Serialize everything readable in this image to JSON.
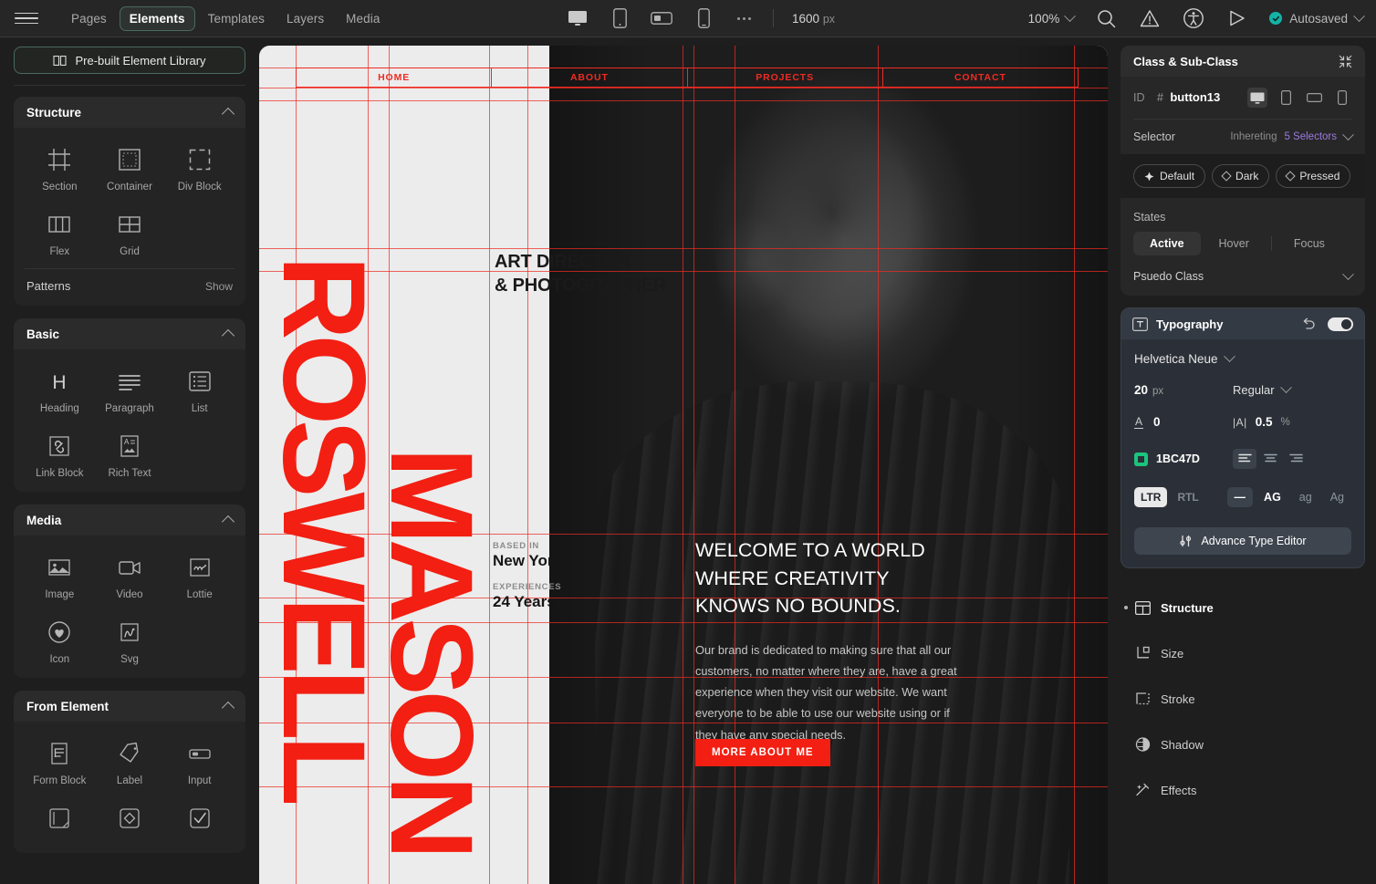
{
  "topbar": {
    "menu_icon": "hamburger-icon",
    "nav": [
      {
        "label": "Pages",
        "active": false
      },
      {
        "label": "Elements",
        "active": true
      },
      {
        "label": "Templates",
        "active": false
      },
      {
        "label": "Layers",
        "active": false
      },
      {
        "label": "Media",
        "active": false
      }
    ],
    "devices": [
      "desktop-icon",
      "tablet-icon",
      "landscape-icon",
      "mobile-icon"
    ],
    "more_label": "more-options-icon",
    "canvas_width": "1600",
    "canvas_width_unit": "px",
    "zoom": "100%",
    "icons": [
      "search-icon",
      "warning-icon",
      "accessibility-icon",
      "preview-play-icon"
    ],
    "autosave_label": "Autosaved",
    "accent_teal": "#13b3a6"
  },
  "left": {
    "library_button": "Pre-built Element Library",
    "sections": [
      {
        "title": "Structure",
        "items": [
          {
            "label": "Section",
            "icon": "section-icon"
          },
          {
            "label": "Container",
            "icon": "container-icon"
          },
          {
            "label": "Div Block",
            "icon": "div-block-icon"
          },
          {
            "label": "Flex",
            "icon": "flex-icon"
          },
          {
            "label": "Grid",
            "icon": "grid-icon"
          }
        ],
        "footer": {
          "label": "Patterns",
          "action": "Show"
        }
      },
      {
        "title": "Basic",
        "items": [
          {
            "label": "Heading",
            "icon": "heading-icon"
          },
          {
            "label": "Paragraph",
            "icon": "paragraph-icon"
          },
          {
            "label": "List",
            "icon": "list-icon"
          },
          {
            "label": "Link Block",
            "icon": "link-block-icon"
          },
          {
            "label": "Rich Text",
            "icon": "rich-text-icon"
          }
        ]
      },
      {
        "title": "Media",
        "items": [
          {
            "label": "Image",
            "icon": "image-icon"
          },
          {
            "label": "Video",
            "icon": "video-icon"
          },
          {
            "label": "Lottie",
            "icon": "lottie-icon"
          },
          {
            "label": "Icon",
            "icon": "heart-icon"
          },
          {
            "label": "Svg",
            "icon": "svg-icon"
          }
        ]
      },
      {
        "title": "From Element",
        "items": [
          {
            "label": "Form Block",
            "icon": "form-block-icon"
          },
          {
            "label": "Label",
            "icon": "tag-icon"
          },
          {
            "label": "Input",
            "icon": "input-icon"
          },
          {
            "label": "",
            "icon": "textarea-icon"
          },
          {
            "label": "",
            "icon": "radio-icon"
          },
          {
            "label": "",
            "icon": "checkbox-icon"
          }
        ]
      }
    ]
  },
  "canvas": {
    "nav_links": [
      "HOME",
      "ABOUT",
      "PROJECTS",
      "CONTACT"
    ],
    "name_line1": "ROSWELL",
    "name_line2": "MASON",
    "role_line1": "ART DIRECTOR",
    "role_line2": "& PHOTOGRAPHER",
    "meta": [
      {
        "key": "BASED IN",
        "value": "New York"
      },
      {
        "key": "EXPERIENCES",
        "value": "24 Years"
      }
    ],
    "headline": "WELCOME TO A WORLD WHERE CREATIVITY KNOWS NO BOUNDS.",
    "paragraph": "Our brand is dedicated to making sure that all our customers, no matter where they are, have a great experience when they visit our website. We want everyone to be able to use our website using or if they have any special needs.",
    "cta": "MORE ABOUT ME",
    "accent_red": "#f21f12",
    "guide_color": "#ef2b23"
  },
  "right": {
    "class_card": {
      "title": "Class & Sub-Class",
      "collapse_icon": "collapse-icon",
      "id_label": "ID",
      "id_hash": "#",
      "id_value": "button13",
      "breakpoints": [
        "desktop-icon",
        "tablet-icon",
        "landscape-icon",
        "mobile-icon"
      ],
      "selector_label": "Selector",
      "inheriting_label": "Inhereting",
      "selector_count": "5 Selectors",
      "selector_count_color": "#9b7ae0",
      "chips": [
        {
          "label": "Default",
          "selected": true
        },
        {
          "label": "Dark",
          "selected": false
        },
        {
          "label": "Pressed",
          "selected": false
        }
      ],
      "states_label": "States",
      "states": [
        {
          "label": "Active",
          "selected": true
        },
        {
          "label": "Hover",
          "selected": false
        },
        {
          "label": "Focus",
          "selected": false
        }
      ],
      "pseudo_label": "Psuedo Class"
    },
    "typography": {
      "title": "Typography",
      "icon": "typography-icon",
      "reset_icon": "reset-icon",
      "enabled": true,
      "font_family": "Helvetica Neue",
      "font_size": "20",
      "font_size_unit": "px",
      "font_weight": "Regular",
      "line_height_value": "0",
      "letter_spacing_value": "0.5",
      "letter_spacing_unit": "%",
      "color_hex": "1BC47D",
      "color_value": "#1BC47D",
      "align": [
        "align-left-icon",
        "align-center-icon",
        "align-right-icon"
      ],
      "align_selected": 0,
      "direction": [
        {
          "label": "LTR",
          "selected": true
        },
        {
          "label": "RTL",
          "selected": false
        }
      ],
      "transform": [
        {
          "label": "—",
          "selected": true
        },
        {
          "label": "AG",
          "selected": false
        },
        {
          "label": "ag",
          "selected": false
        },
        {
          "label": "Ag",
          "selected": false
        }
      ],
      "advance_button": "Advance Type Editor"
    },
    "properties": [
      {
        "label": "Structure",
        "icon": "structure-icon",
        "active": true
      },
      {
        "label": "Size",
        "icon": "size-icon",
        "active": false
      },
      {
        "label": "Stroke",
        "icon": "stroke-icon",
        "active": false
      },
      {
        "label": "Shadow",
        "icon": "shadow-icon",
        "active": false
      },
      {
        "label": "Effects",
        "icon": "effects-icon",
        "active": false
      }
    ]
  }
}
